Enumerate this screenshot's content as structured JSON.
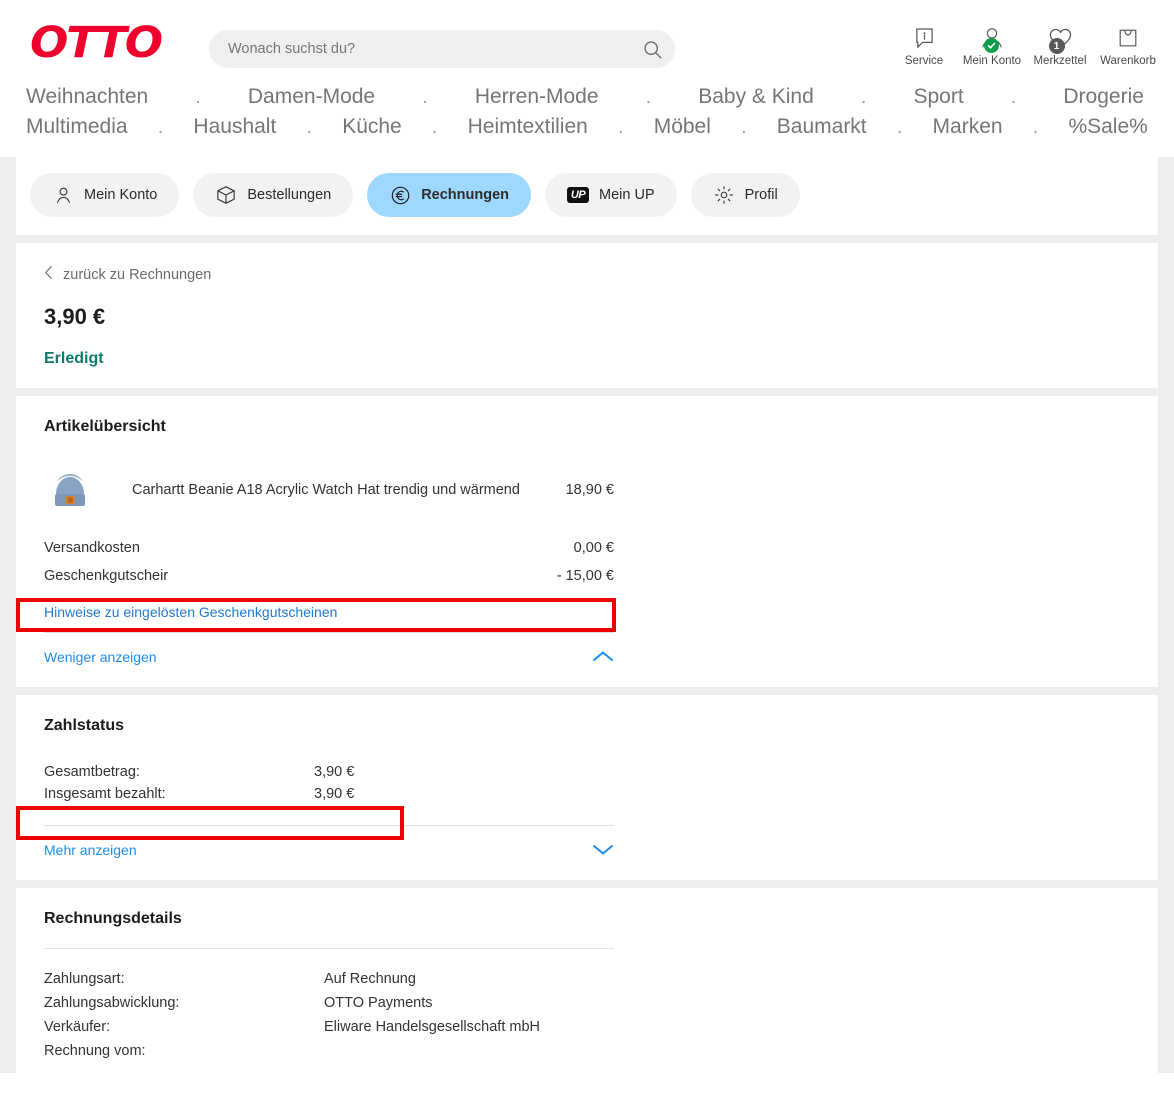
{
  "brand": {
    "logo_text": "OTTO",
    "logo_color": "#f0002d"
  },
  "search": {
    "placeholder": "Wonach suchst du?",
    "value": "",
    "icon": "search-icon"
  },
  "header_icons": [
    {
      "icon": "info-speech-bubble-icon",
      "label": "Service"
    },
    {
      "icon": "user-account-icon",
      "label": "Mein Konto",
      "badge": "check"
    },
    {
      "icon": "heart-icon",
      "label": "Merkzettel",
      "badge_count": "1"
    },
    {
      "icon": "shopping-bag-icon",
      "label": "Warenkorb"
    }
  ],
  "nav": {
    "row1": [
      "Weihnachten",
      "Damen-Mode",
      "Herren-Mode",
      "Baby & Kind",
      "Sport",
      "Drogerie"
    ],
    "row2": [
      "Multimedia",
      "Haushalt",
      "Küche",
      "Heimtextilien",
      "Möbel",
      "Baumarkt",
      "Marken",
      "%Sale%"
    ],
    "separator": "."
  },
  "tabs": [
    {
      "label": "Mein Konto",
      "icon": "user-icon",
      "active": false
    },
    {
      "label": "Bestellungen",
      "icon": "package-box-icon",
      "active": false
    },
    {
      "label": "Rechnungen",
      "icon": "euro-circle-icon",
      "active": true
    },
    {
      "label": "Mein UP",
      "icon": "up-badge-icon",
      "active": false
    },
    {
      "label": "Profil",
      "icon": "gear-icon",
      "active": false
    }
  ],
  "summary": {
    "back_label": "zurück zu Rechnungen",
    "back_icon": "chevron-left-icon",
    "amount": "3,90 €",
    "status": "Erledigt",
    "status_color": "#0f7b6c"
  },
  "article_overview": {
    "title": "Artikelübersicht",
    "item": {
      "image": "blue-beanie-hat-thumbnail",
      "name": "Carhartt Beanie A18 Acrylic Watch Hat trendig und wärmend",
      "price": "18,90 €"
    },
    "rows": [
      {
        "label": "Versandkosten",
        "value": "0,00 €",
        "highlighted": false
      },
      {
        "label": "Geschenkgutscheir",
        "value": "- 15,00 €",
        "highlighted": true
      }
    ],
    "info_link": "Hinweise zu eingelösten Geschenkgutscheinen",
    "toggle_label": "Weniger anzeigen",
    "toggle_icon": "chevron-up-icon"
  },
  "payment_status": {
    "title": "Zahlstatus",
    "rows": [
      {
        "label": "Gesamtbetrag:",
        "value": "3,90 €",
        "highlighted": true
      },
      {
        "label": "Insgesamt bezahlt:",
        "value": "3,90 €",
        "highlighted": false
      }
    ],
    "toggle_label": "Mehr anzeigen",
    "toggle_icon": "chevron-down-icon"
  },
  "invoice_details": {
    "title": "Rechnungsdetails",
    "rows": [
      {
        "label": "Zahlungsart:",
        "value": "Auf Rechnung"
      },
      {
        "label": "Zahlungsabwicklung:",
        "value": "OTTO Payments"
      },
      {
        "label": "Verkäufer:",
        "value": "Eliware Handelsgesellschaft mbH"
      },
      {
        "label": "Rechnung vom:",
        "value": ""
      }
    ]
  },
  "annotations": {
    "box_color": "#ef0000"
  }
}
